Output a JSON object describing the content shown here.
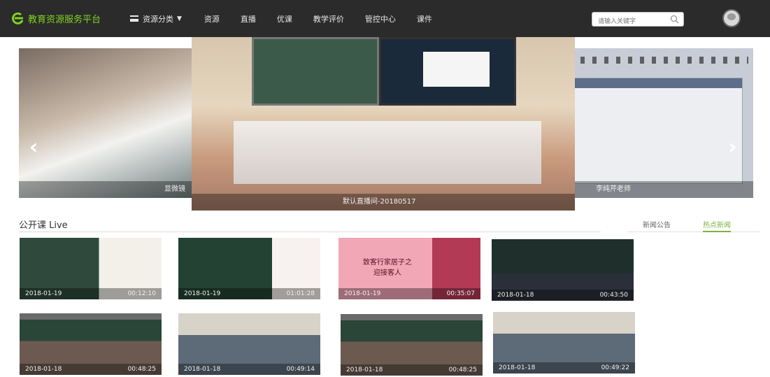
{
  "header": {
    "logo_text": "教育资源服务平台",
    "nav": {
      "menu_label": "资源分类",
      "items": [
        "资源",
        "直播",
        "优课",
        "教学评价",
        "管控中心",
        "课件"
      ]
    },
    "search_placeholder": "请输入关键字"
  },
  "carousel": {
    "left_caption": "显微镜",
    "center_caption": "默认直播间-20180517",
    "right_caption": "李纯芹老师"
  },
  "section": {
    "title": "公开课 Live"
  },
  "news_tabs": {
    "items": [
      "新闻公告",
      "热点新闻"
    ],
    "active": "热点新闻"
  },
  "videos": [
    {
      "date": "2018-01-19",
      "duration": "00:12:10",
      "title_overlay": "",
      "style": "screen-board"
    },
    {
      "date": "2018-01-19",
      "duration": "01:01:28",
      "title_overlay": "",
      "style": "board-teacher"
    },
    {
      "date": "2018-01-19",
      "duration": "00:35:07",
      "title_overlay": "致客行家居子之\n迎接客人",
      "style": "pink-pattern"
    },
    {
      "date": "2018-01-18",
      "duration": "00:43:50",
      "title_overlay": "",
      "style": "classroom-dark"
    },
    {
      "date": "2018-01-18",
      "duration": "00:48:25",
      "title_overlay": "",
      "style": "classroom-screen"
    },
    {
      "date": "2018-01-18",
      "duration": "00:49:14",
      "title_overlay": "",
      "style": "computer-lab"
    },
    {
      "date": "2018-01-18",
      "duration": "00:48:25",
      "title_overlay": "",
      "style": "classroom-screen"
    },
    {
      "date": "2018-01-18",
      "duration": "00:49:22",
      "title_overlay": "",
      "style": "computer-lab"
    }
  ],
  "colors": {
    "topbar": "#2b2b2b",
    "logo_green": "#7ed321",
    "active_tab": "#7cb342"
  }
}
